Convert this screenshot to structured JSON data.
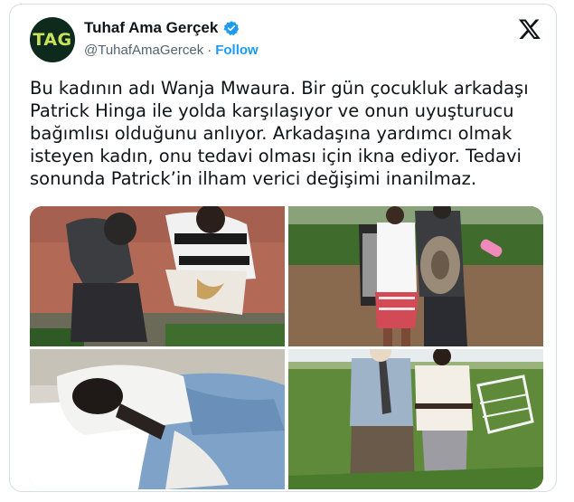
{
  "author": {
    "avatar_text": "TAG",
    "display_name": "Tuhaf Ama Gerçek",
    "handle": "@TuhafAmaGercek",
    "separator": "·",
    "follow_label": "Follow"
  },
  "tweet": {
    "text": "Bu kadının adı Wanja Mwaura. Bir gün çocukluk arkadaşı Patrick Hinga ile yolda karşılaşıyor ve onun uyuşturucu bağımlısı olduğunu anlıyor. Arkadaşına yardımcı olmak isteyen kadın, onu tedavi olması için ikna ediyor. Tedavi sonunda Patrick’in ilham verici değişimi inanilmaz."
  },
  "media": [
    "photo-roadside-meeting",
    "photo-standing-together",
    "photo-hospital-bed",
    "photo-after-recovery"
  ],
  "colors": {
    "brand_blue": "#1d9bf0",
    "text": "#0f1419",
    "muted": "#536471",
    "avatar_bg": "#0e2a1c",
    "avatar_text": "#c9e25a"
  },
  "icons": [
    "verified-badge-icon",
    "x-logo-icon"
  ]
}
